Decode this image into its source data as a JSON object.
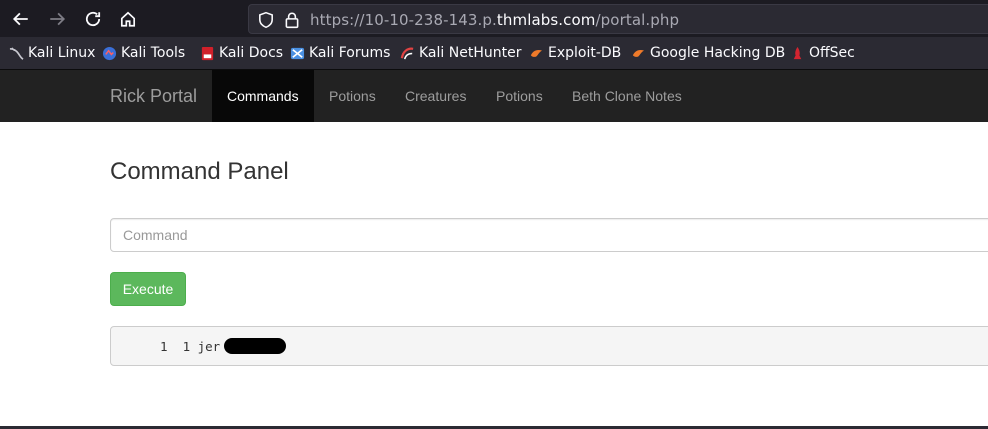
{
  "browser": {
    "url_prefix": "https://10-10-238-143.p.",
    "url_host": "thmlabs.com",
    "url_path": "/portal.php"
  },
  "bookmarks": [
    {
      "label": "Kali Linux",
      "icon": "kali-dragon-icon"
    },
    {
      "label": "Kali Tools",
      "icon": "kali-tools-icon"
    },
    {
      "label": "Kali Docs",
      "icon": "kali-docs-icon"
    },
    {
      "label": "Kali Forums",
      "icon": "kali-forums-icon"
    },
    {
      "label": "Kali NetHunter",
      "icon": "nethunter-icon"
    },
    {
      "label": "Exploit-DB",
      "icon": "exploit-db-icon"
    },
    {
      "label": "Google Hacking DB",
      "icon": "ghdb-icon"
    },
    {
      "label": "OffSec",
      "icon": "offsec-icon"
    }
  ],
  "site": {
    "brand": "Rick Portal",
    "nav": [
      {
        "label": "Commands",
        "active": true
      },
      {
        "label": "Potions",
        "active": false
      },
      {
        "label": "Creatures",
        "active": false
      },
      {
        "label": "Potions",
        "active": false
      },
      {
        "label": "Beth Clone Notes",
        "active": false
      }
    ]
  },
  "panel": {
    "title": "Command Panel",
    "input_placeholder": "Command",
    "input_value": "",
    "execute_label": "Execute",
    "output_text": "1  1 jer"
  },
  "colors": {
    "navbar_bg": "#222222",
    "nav_active_bg": "#080808",
    "execute_btn": "#5cb85c",
    "browser_toolbar": "#1c1b22"
  }
}
